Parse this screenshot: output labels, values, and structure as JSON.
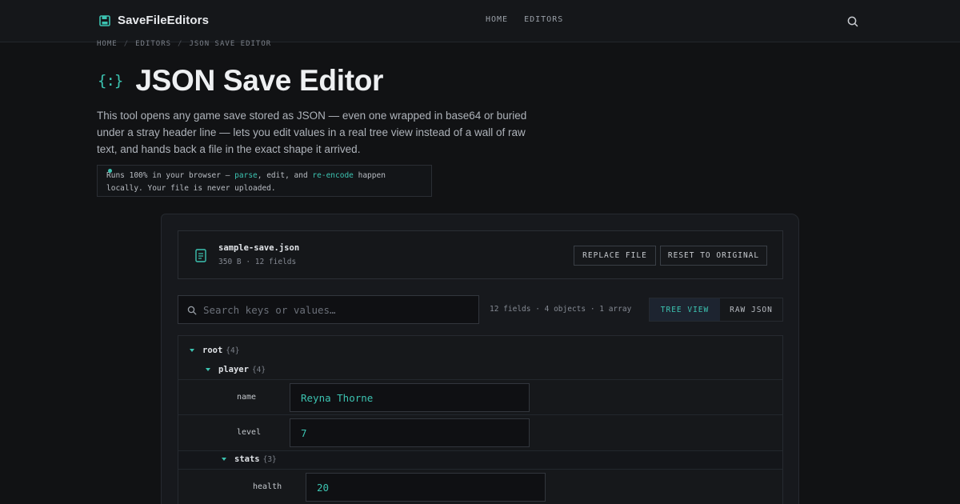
{
  "header": {
    "brand": "SaveFileEditors",
    "brand_icon": "save-icon",
    "nav": [
      "HOME",
      "EDITORS"
    ],
    "search_icon": "search-icon"
  },
  "breadcrumb": [
    "HOME",
    "EDITORS",
    "JSON SAVE EDITOR"
  ],
  "breadcrumb_sep": "/",
  "page": {
    "icon_glyph": "{:}",
    "title": "JSON Save Editor",
    "intro": "This tool opens any game save stored as JSON — even one wrapped in base64 or buried under a stray header line — lets you edit values in a real tree view instead of a wall of raw text, and hands back a file in the exact shape it arrived.",
    "notice": {
      "part1": "Runs 100% in your browser — ",
      "hl1": "parse",
      "part2": ", edit, and ",
      "hl2": "re-encode",
      "part3": " happen locally. Your file is never uploaded."
    }
  },
  "editor": {
    "file_icon": "file-icon",
    "file_name": "sample-save.json",
    "file_meta": "350 B · 12 fields",
    "replace_label": "REPLACE FILE",
    "reset_label": "RESET TO ORIGINAL",
    "search_placeholder": "Search keys or values…",
    "stats": "12 fields · 4 objects · 1 array",
    "view_tree": "TREE VIEW",
    "view_raw": "RAW JSON",
    "active_view": "TREE VIEW",
    "tree": {
      "root": {
        "key": "root",
        "count": "{4}"
      },
      "player": {
        "key": "player",
        "count": "{4}"
      },
      "name": {
        "key": "name",
        "value": "Reyna Thorne"
      },
      "level": {
        "key": "level",
        "value": "7"
      },
      "stats": {
        "key": "stats",
        "count": "{3}"
      },
      "health": {
        "key": "health",
        "value": "20"
      }
    }
  },
  "colors": {
    "accent": "#3cc3b1",
    "background": "#111214",
    "panel": "#17191d"
  }
}
